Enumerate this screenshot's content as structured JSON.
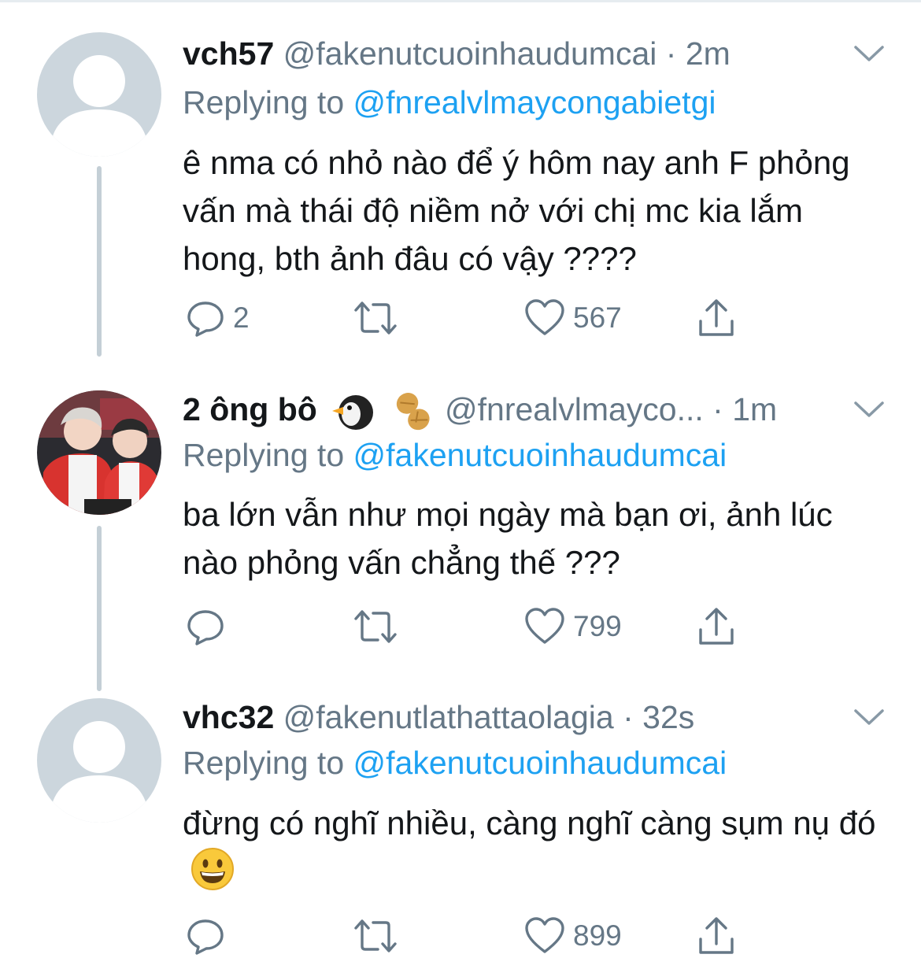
{
  "tweets": [
    {
      "name": "vch57",
      "handle": "@fakenutcuoinhaudumcai",
      "dot": "·",
      "time": "2m",
      "replying_prefix": "Replying to ",
      "replying_to": "@fnrealvlmaycongabietgi",
      "text": "ê nma có nhỏ nào để ý hôm nay anh F phỏng vấn mà thái độ niềm nở với chị mc kia lắm hong, bth ảnh đâu có vậy ????",
      "reply_count": "2",
      "retweet_count": "",
      "like_count": "567",
      "avatar": "default-avatar-icon"
    },
    {
      "name": "2 ông bô",
      "name_emojis": [
        "penguin-emoji",
        "peanut-emoji"
      ],
      "handle": "@fnrealvlmayco...",
      "dot": "·",
      "time": "1m",
      "replying_prefix": "Replying to ",
      "replying_to": "@fakenutcuoinhaudumcai",
      "text": "ba lớn vẫn như mọi ngày mà bạn ơi, ảnh lúc nào phỏng vấn chẳng thế ???",
      "reply_count": "",
      "retweet_count": "",
      "like_count": "799",
      "avatar": "photo-avatar"
    },
    {
      "name": "vhc32",
      "handle": "@fakenutlathattaolagia",
      "dot": "·",
      "time": "32s",
      "replying_prefix": "Replying to ",
      "replying_to": "@fakenutcuoinhaudumcai",
      "text": "đừng có nghĩ nhiều, càng nghĩ càng sụm nụ đó",
      "text_emoji": "grinning-face-emoji",
      "reply_count": "",
      "retweet_count": "",
      "like_count": "899",
      "avatar": "default-avatar-icon"
    }
  ],
  "colors": {
    "link": "#1da1f2",
    "muted": "#657786",
    "text": "#14171a",
    "thread_line": "#c4cfd6",
    "avatar_placeholder": "#ccd6dd"
  }
}
